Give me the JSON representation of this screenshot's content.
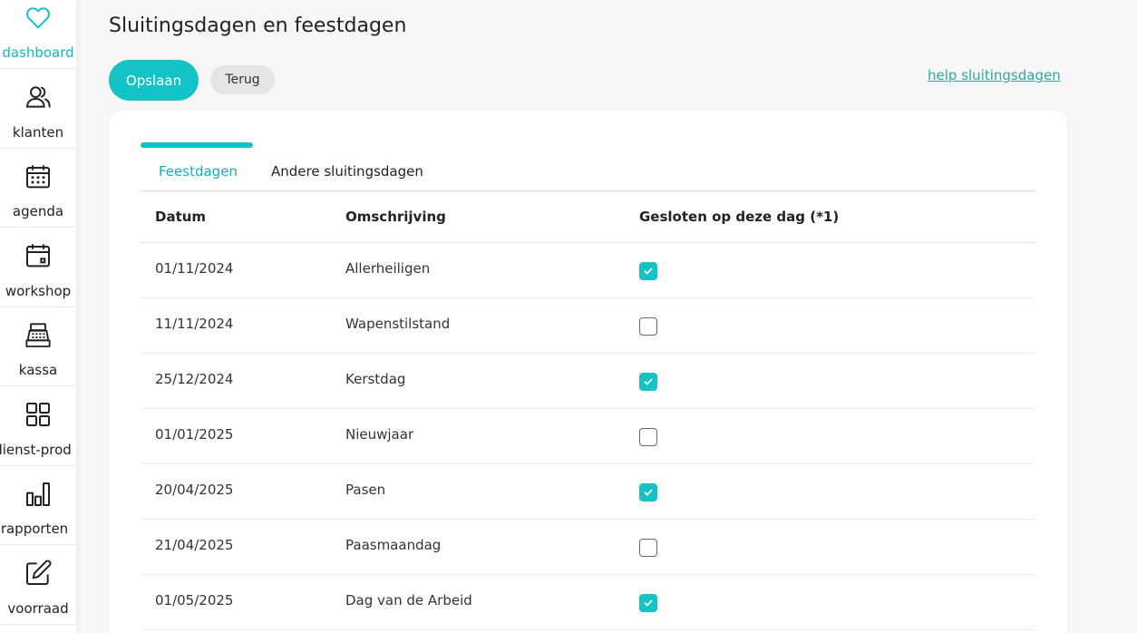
{
  "colors": {
    "accent": "#14c3c6",
    "link": "#2aa6ab"
  },
  "sidebar": {
    "items": [
      {
        "label": "dashboard",
        "icon": "heart-icon",
        "active": true
      },
      {
        "label": "klanten",
        "icon": "users-icon"
      },
      {
        "label": "agenda",
        "icon": "calendar-icon"
      },
      {
        "label": "workshop",
        "icon": "calendar-event-icon"
      },
      {
        "label": "kassa",
        "icon": "cash-register-icon"
      },
      {
        "label": "dienst-prod",
        "icon": "grid-icon"
      },
      {
        "label": "rapporten",
        "icon": "bar-chart-icon"
      },
      {
        "label": "voorraad",
        "icon": "edit-icon"
      }
    ]
  },
  "header": {
    "title": "Sluitingsdagen en feestdagen",
    "save_label": "Opslaan",
    "back_label": "Terug",
    "help_link": "help sluitingsdagen"
  },
  "tabs": [
    {
      "label": "Feestdagen",
      "active": true
    },
    {
      "label": "Andere sluitingsdagen",
      "active": false
    }
  ],
  "table": {
    "columns": [
      "Datum",
      "Omschrijving",
      "Gesloten op deze dag (*1)"
    ],
    "rows": [
      {
        "date": "01/11/2024",
        "description": "Allerheiligen",
        "closed": true
      },
      {
        "date": "11/11/2024",
        "description": "Wapenstilstand",
        "closed": false
      },
      {
        "date": "25/12/2024",
        "description": "Kerstdag",
        "closed": true
      },
      {
        "date": "01/01/2025",
        "description": "Nieuwjaar",
        "closed": false
      },
      {
        "date": "20/04/2025",
        "description": "Pasen",
        "closed": true
      },
      {
        "date": "21/04/2025",
        "description": "Paasmaandag",
        "closed": false
      },
      {
        "date": "01/05/2025",
        "description": "Dag van de Arbeid",
        "closed": true
      }
    ]
  }
}
